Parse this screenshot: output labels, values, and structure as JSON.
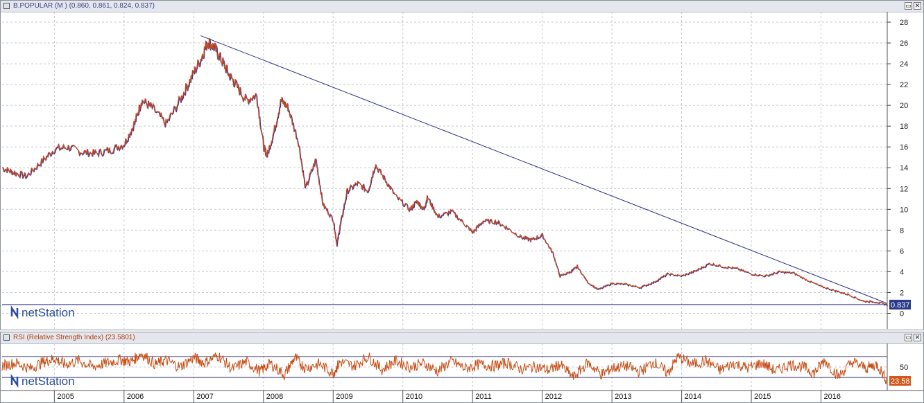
{
  "main_panel": {
    "title": "B.POPULAR (M ) (0.860, 0.861, 0.824, 0.837)",
    "close_glyph": "✕",
    "last_price_label": "0.837",
    "watermark": "netStation",
    "icons": [
      "window-menu-icon",
      "restore-icon",
      "close-icon"
    ]
  },
  "rsi_panel": {
    "title": "RSI (Relative Strength Index) (23.5801)",
    "last_value_label": "23.58",
    "watermark": "netStation"
  },
  "colors": {
    "price_up": "#2b2fa0",
    "price_down": "#cc4a16",
    "trendline": "#2a2f8a",
    "rsi_line": "#c84c14",
    "last_price_badge": "#2b3a8a",
    "rsi_badge": "#d2561a"
  },
  "chart_data": [
    {
      "type": "line",
      "title": "B.POPULAR (M ) (0.860, 0.861, 0.824, 0.837)",
      "x_labels": [
        "2005",
        "2006",
        "2007",
        "2008",
        "2009",
        "2010",
        "2011",
        "2012",
        "2013",
        "2014",
        "2015",
        "2016"
      ],
      "y_ticks": [
        0,
        2,
        4,
        6,
        8,
        10,
        12,
        14,
        16,
        18,
        20,
        22,
        24,
        26,
        28
      ],
      "ylim": [
        -1.5,
        29
      ],
      "xlim": [
        2004.25,
        2016.95
      ],
      "grid": true,
      "series": [
        {
          "x": [
            2004.25,
            2004.4,
            2004.6,
            2004.8,
            2005.0,
            2005.2,
            2005.4,
            2005.6,
            2005.8,
            2006.0,
            2006.15,
            2006.25,
            2006.4,
            2006.6,
            2006.8,
            2006.95,
            2007.1,
            2007.2,
            2007.3,
            2007.4,
            2007.5,
            2007.6,
            2007.75,
            2007.9,
            2008.0,
            2008.05,
            2008.15,
            2008.25,
            2008.35,
            2008.5,
            2008.6,
            2008.75,
            2008.85,
            2009.0,
            2009.05,
            2009.1,
            2009.2,
            2009.35,
            2009.5,
            2009.6,
            2009.75,
            2009.9,
            2010.1,
            2010.2,
            2010.3,
            2010.35,
            2010.5,
            2010.7,
            2010.9,
            2011.0,
            2011.15,
            2011.35,
            2011.5,
            2011.7,
            2011.85,
            2012.0,
            2012.15,
            2012.25,
            2012.4,
            2012.5,
            2012.65,
            2012.8,
            2013.0,
            2013.2,
            2013.4,
            2013.6,
            2013.8,
            2014.0,
            2014.2,
            2014.4,
            2014.6,
            2014.8,
            2015.0,
            2015.2,
            2015.4,
            2015.6,
            2015.8,
            2016.0,
            2016.2,
            2016.4,
            2016.6,
            2016.8,
            2016.95
          ],
          "values": [
            14.0,
            13.6,
            13.2,
            14.5,
            15.8,
            16.0,
            15.5,
            15.4,
            15.7,
            16.3,
            18.3,
            20.5,
            19.8,
            18.2,
            20.5,
            22.5,
            24.5,
            26.2,
            25.5,
            24.3,
            23.0,
            22.0,
            20.5,
            21.0,
            16.0,
            15.2,
            17.5,
            20.5,
            19.8,
            16.5,
            12.0,
            14.8,
            10.5,
            9.0,
            6.6,
            8.5,
            11.8,
            12.5,
            11.8,
            14.3,
            12.8,
            11.2,
            10.0,
            10.8,
            10.0,
            11.2,
            9.3,
            9.8,
            8.5,
            7.8,
            8.9,
            8.8,
            8.2,
            7.3,
            7.1,
            7.5,
            5.8,
            3.6,
            4.0,
            4.5,
            3.0,
            2.3,
            2.9,
            2.8,
            2.5,
            3.0,
            3.8,
            3.6,
            4.1,
            4.8,
            4.5,
            4.3,
            3.8,
            3.6,
            4.0,
            3.9,
            3.2,
            2.6,
            2.2,
            1.8,
            1.2,
            1.1,
            0.837
          ]
        }
      ],
      "trendline": {
        "x": [
          2007.1,
          2016.95
        ],
        "values": [
          26.7,
          0.95
        ]
      },
      "horizontal_line": 0.837
    },
    {
      "type": "line",
      "title": "RSI (Relative Strength Index) (23.5801)",
      "y_ticks": [
        50
      ],
      "ylim": [
        5,
        95
      ],
      "reference_lines": [
        70,
        30
      ],
      "series": [
        {
          "x": [
            2004.25,
            2004.45,
            2004.65,
            2004.85,
            2005.0,
            2005.15,
            2005.35,
            2005.55,
            2005.75,
            2005.95,
            2006.1,
            2006.25,
            2006.45,
            2006.6,
            2006.8,
            2007.0,
            2007.15,
            2007.35,
            2007.55,
            2007.75,
            2007.95,
            2008.1,
            2008.3,
            2008.45,
            2008.6,
            2008.8,
            2009.0,
            2009.1,
            2009.3,
            2009.5,
            2009.7,
            2009.9,
            2010.1,
            2010.3,
            2010.5,
            2010.7,
            2010.9,
            2011.1,
            2011.3,
            2011.5,
            2011.7,
            2011.9,
            2012.1,
            2012.25,
            2012.45,
            2012.65,
            2012.85,
            2013.0,
            2013.2,
            2013.4,
            2013.6,
            2013.8,
            2013.95,
            2014.15,
            2014.35,
            2014.55,
            2014.75,
            2014.95,
            2015.15,
            2015.35,
            2015.55,
            2015.75,
            2015.9,
            2016.05,
            2016.25,
            2016.45,
            2016.65,
            2016.8,
            2016.95
          ],
          "values": [
            52,
            58,
            47,
            60,
            66,
            55,
            62,
            50,
            58,
            64,
            60,
            76,
            55,
            63,
            50,
            68,
            58,
            72,
            46,
            60,
            42,
            57,
            35,
            68,
            48,
            56,
            38,
            60,
            52,
            70,
            45,
            62,
            50,
            57,
            42,
            61,
            47,
            55,
            52,
            58,
            46,
            51,
            44,
            55,
            30,
            58,
            36,
            48,
            52,
            41,
            60,
            38,
            70,
            55,
            62,
            44,
            57,
            48,
            58,
            42,
            55,
            50,
            38,
            63,
            32,
            60,
            48,
            55,
            23.58
          ]
        }
      ]
    }
  ]
}
